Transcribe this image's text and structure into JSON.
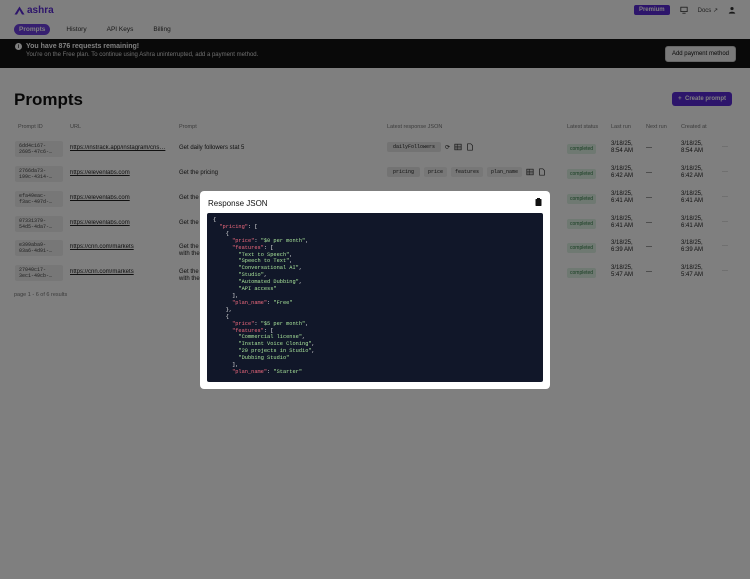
{
  "app": {
    "name": "ashra"
  },
  "header": {
    "premium": "Premium",
    "docs": "Docs"
  },
  "tabs": [
    {
      "label": "Prompts",
      "active": true
    },
    {
      "label": "History"
    },
    {
      "label": "API Keys"
    },
    {
      "label": "Billing"
    }
  ],
  "banner": {
    "title": "You have 876 requests remaining!",
    "subtitle": "You're on the Free plan. To continue using Ashra uninterrupted, add a payment method.",
    "button": "Add payment method"
  },
  "page": {
    "title": "Prompts",
    "create_button": "Create prompt"
  },
  "table": {
    "headers": [
      "Prompt ID",
      "URL",
      "Prompt",
      "Latest response JSON",
      "Latest status",
      "Last run",
      "Next run",
      "Created at"
    ],
    "rows": [
      {
        "id1": "6dd4c167-",
        "id2": "2605-47c6-…",
        "url": "https://instrack.app/instagram/cris…",
        "prompt": "Get daily followers stat 5",
        "prompt2": "",
        "json": [
          "dailyFollowers"
        ],
        "status": "completed",
        "last1": "3/18/25,",
        "last2": "8:54 AM",
        "next": "—",
        "created1": "3/18/25,",
        "created2": "8:54 AM"
      },
      {
        "id1": "2766da73-",
        "id2": "199c-4314-…",
        "url": "https://elevenlabs.com",
        "prompt": "Get the pricing",
        "prompt2": "",
        "json": [
          "pricing",
          "price",
          "features",
          "plan_name"
        ],
        "status": "completed",
        "last1": "3/18/25,",
        "last2": "6:42 AM",
        "next": "—",
        "created1": "3/18/25,",
        "created2": "6:42 AM"
      },
      {
        "id1": "efa49eac-",
        "id2": "f3ac-497d-…",
        "url": "https://elevenlabs.com",
        "prompt": "Get the",
        "prompt2": "",
        "json": [],
        "status": "completed",
        "last1": "3/18/25,",
        "last2": "6:41 AM",
        "next": "—",
        "created1": "3/18/25,",
        "created2": "6:41 AM"
      },
      {
        "id1": "07331379-",
        "id2": "54d5-4da7-…",
        "url": "https://elevenlabs.com",
        "prompt": "Get the",
        "prompt2": "",
        "json": [],
        "status": "completed",
        "last1": "3/18/25,",
        "last2": "6:41 AM",
        "next": "—",
        "created1": "3/18/25,",
        "created2": "6:41 AM"
      },
      {
        "id1": "e399aba9-",
        "id2": "03a6-4d91-…",
        "url": "https://cnn.com/markets",
        "prompt": "Get the",
        "prompt2": "with the",
        "json": [],
        "status": "completed",
        "last1": "3/18/25,",
        "last2": "6:39 AM",
        "next": "—",
        "created1": "3/18/25,",
        "created2": "6:39 AM"
      },
      {
        "id1": "27040c17-",
        "id2": "3ec1-49cb-…",
        "url": "https://cnn.com/markets",
        "prompt": "Get the",
        "prompt2": "with the",
        "json": [],
        "status": "completed",
        "last1": "3/18/25,",
        "last2": "5:47 AM",
        "next": "—",
        "created1": "3/18/25,",
        "created2": "5:47 AM"
      }
    ],
    "pagination": "page 1 - 6 of 6 results"
  },
  "modal": {
    "title": "Response JSON",
    "code_lines": [
      [
        [
          "p",
          "{"
        ]
      ],
      [
        [
          "p",
          "  "
        ],
        [
          "k",
          "\"pricing\""
        ],
        [
          "p",
          ": ["
        ]
      ],
      [
        [
          "p",
          "    {"
        ]
      ],
      [
        [
          "p",
          "      "
        ],
        [
          "k",
          "\"price\""
        ],
        [
          "p",
          ": "
        ],
        [
          "s",
          "\"$0 per month\""
        ],
        [
          "p",
          ","
        ]
      ],
      [
        [
          "p",
          "      "
        ],
        [
          "k",
          "\"features\""
        ],
        [
          "p",
          ": ["
        ]
      ],
      [
        [
          "p",
          "        "
        ],
        [
          "s",
          "\"Text to Speech\""
        ],
        [
          "p",
          ","
        ]
      ],
      [
        [
          "p",
          "        "
        ],
        [
          "s",
          "\"Speech to Text\""
        ],
        [
          "p",
          ","
        ]
      ],
      [
        [
          "p",
          "        "
        ],
        [
          "s",
          "\"Conversational AI\""
        ],
        [
          "p",
          ","
        ]
      ],
      [
        [
          "p",
          "        "
        ],
        [
          "s",
          "\"Studio\""
        ],
        [
          "p",
          ","
        ]
      ],
      [
        [
          "p",
          "        "
        ],
        [
          "s",
          "\"Automated Dubbing\""
        ],
        [
          "p",
          ","
        ]
      ],
      [
        [
          "p",
          "        "
        ],
        [
          "s",
          "\"API access\""
        ]
      ],
      [
        [
          "p",
          "      ],"
        ]
      ],
      [
        [
          "p",
          "      "
        ],
        [
          "k",
          "\"plan_name\""
        ],
        [
          "p",
          ": "
        ],
        [
          "s",
          "\"Free\""
        ]
      ],
      [
        [
          "p",
          "    },"
        ]
      ],
      [
        [
          "p",
          "    {"
        ]
      ],
      [
        [
          "p",
          "      "
        ],
        [
          "k",
          "\"price\""
        ],
        [
          "p",
          ": "
        ],
        [
          "s",
          "\"$5 per month\""
        ],
        [
          "p",
          ","
        ]
      ],
      [
        [
          "p",
          "      "
        ],
        [
          "k",
          "\"features\""
        ],
        [
          "p",
          ": ["
        ]
      ],
      [
        [
          "p",
          "        "
        ],
        [
          "s",
          "\"Commercial license\""
        ],
        [
          "p",
          ","
        ]
      ],
      [
        [
          "p",
          "        "
        ],
        [
          "s",
          "\"Instant Voice Cloning\""
        ],
        [
          "p",
          ","
        ]
      ],
      [
        [
          "p",
          "        "
        ],
        [
          "s",
          "\"20 projects in Studio\""
        ],
        [
          "p",
          ","
        ]
      ],
      [
        [
          "p",
          "        "
        ],
        [
          "s",
          "\"Dubbing Studio\""
        ]
      ],
      [
        [
          "p",
          "      ],"
        ]
      ],
      [
        [
          "p",
          "      "
        ],
        [
          "k",
          "\"plan_name\""
        ],
        [
          "p",
          ": "
        ],
        [
          "s",
          "\"Starter\""
        ]
      ]
    ]
  },
  "colors": {
    "brand": "#5b2bd6",
    "banner": "#121212",
    "code_bg": "#111729",
    "key": "#f16a7e",
    "string": "#a8e39a"
  }
}
